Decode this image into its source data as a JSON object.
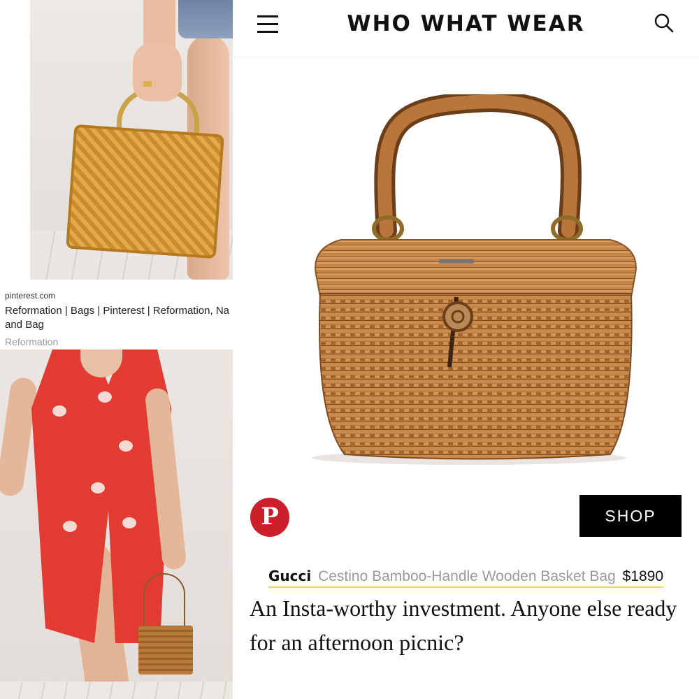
{
  "pinterest": {
    "source": "pinterest.com",
    "title": "Reformation | Bags | Pinterest | Reformation, Na and Bag",
    "brand": "Reformation"
  },
  "site": {
    "logo": "WHO WHAT WEAR",
    "menu_icon": "hamburger-menu-icon",
    "search_icon": "search-icon"
  },
  "product": {
    "brand": "Gucci",
    "name": "Cestino Bamboo-Handle Wooden Basket Bag",
    "price": "$1890",
    "shop_label": "SHOP",
    "pin_label": "P",
    "caption": "An Insta-worthy investment. Anyone else ready for an afternoon picnic?"
  },
  "colors": {
    "pinterest_red": "#cb1f2a",
    "shop_bg": "#000000",
    "link_underline": "#e7d95c",
    "dress_red": "#e23b31",
    "wicker": "#b8773a"
  }
}
